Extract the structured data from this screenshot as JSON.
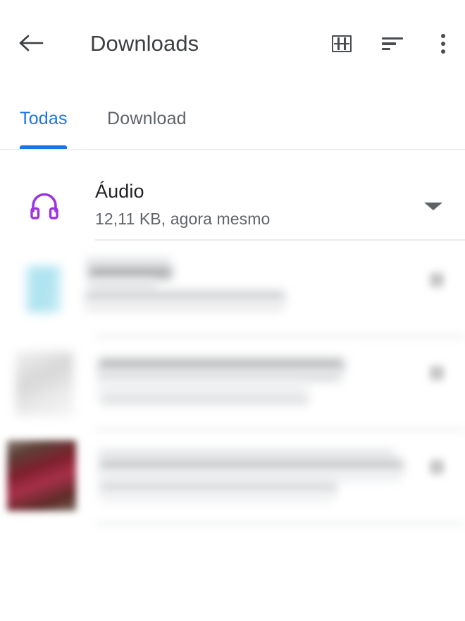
{
  "appbar": {
    "back_icon": "arrow-back-icon",
    "title": "Downloads",
    "actions": [
      {
        "icon": "grid-view-icon",
        "label": "Grid view"
      },
      {
        "icon": "sort-icon",
        "label": "Sort"
      },
      {
        "icon": "overflow-menu-icon",
        "label": "More options"
      }
    ]
  },
  "tabs": {
    "active_index": 0,
    "items": [
      {
        "label": "Todas",
        "active": true
      },
      {
        "label": "Download",
        "active": false
      }
    ]
  },
  "list": {
    "header_item": {
      "icon": "headphones-icon",
      "title": "Áudio",
      "subtitle": "12,11 KB, agora mesmo",
      "expander_icon": "caret-down-icon"
    },
    "file_items": [
      {
        "title": "",
        "subtitle": "",
        "thumbnail": "blurred-cyan-document-thumbnail",
        "overflow_icon": "overflow-menu-icon",
        "redacted": true
      },
      {
        "title": "",
        "subtitle": "",
        "thumbnail": "blurred-gray-thumbnail",
        "overflow_icon": "overflow-menu-icon",
        "redacted": true
      },
      {
        "title": "",
        "subtitle": "",
        "thumbnail": "blurred-dark-red-thumbnail",
        "overflow_icon": "overflow-menu-icon",
        "redacted": true
      }
    ]
  },
  "colors": {
    "accent_blue": "#1a73e8",
    "audio_purple": "#9b34e0",
    "title_text": "#202124",
    "secondary_text": "#5f6368",
    "icon_gray": "#4a4d50",
    "divider": "#e8eaed",
    "background": "#ffffff"
  }
}
